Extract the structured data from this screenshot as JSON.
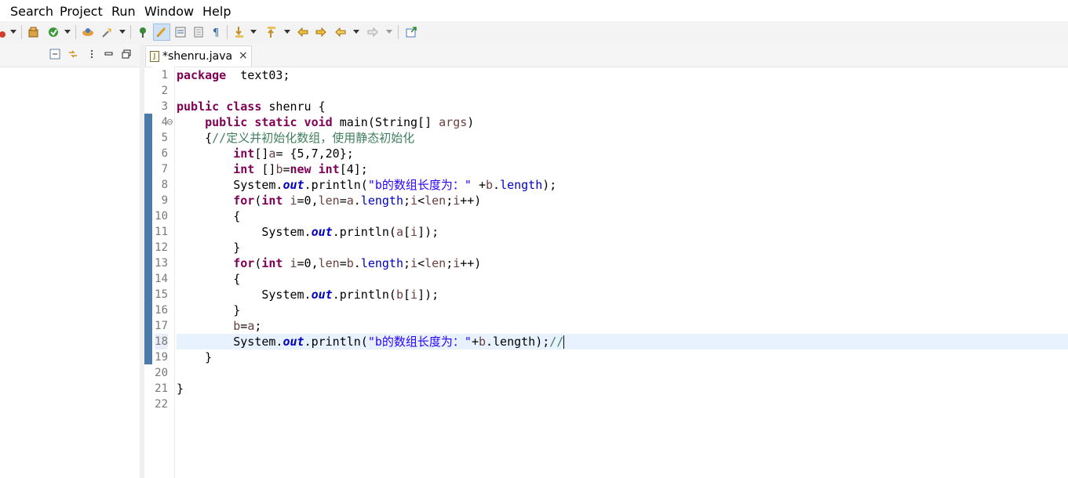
{
  "menu": [
    "Search",
    "Project",
    "Run",
    "Window",
    "Help"
  ],
  "editor": {
    "tab": {
      "label": "*shenru.java",
      "close": "×",
      "file_badge": "J"
    },
    "current_line": 18,
    "line_numbers": [
      "1",
      "2",
      "3",
      "4",
      "5",
      "6",
      "7",
      "8",
      "9",
      "10",
      "11",
      "12",
      "13",
      "14",
      "15",
      "16",
      "17",
      "18",
      "19",
      "20",
      "21",
      "22"
    ],
    "lines": [
      {
        "n": 1,
        "tokens": [
          [
            "kw",
            "package"
          ],
          [
            "",
            "  text03;"
          ]
        ]
      },
      {
        "n": 2,
        "tokens": []
      },
      {
        "n": 3,
        "tokens": [
          [
            "kw",
            "public class"
          ],
          [
            "",
            " shenru {"
          ]
        ]
      },
      {
        "n": 4,
        "tokens": [
          [
            "",
            "    "
          ],
          [
            "kw",
            "public static void"
          ],
          [
            "",
            " main(String[] "
          ],
          [
            "var",
            "args"
          ],
          [
            "",
            ")"
          ]
        ]
      },
      {
        "n": 5,
        "tokens": [
          [
            "",
            "    {"
          ],
          [
            "cmt",
            "//定义并初始化数组，使用静态初始化"
          ]
        ]
      },
      {
        "n": 6,
        "tokens": [
          [
            "",
            "        "
          ],
          [
            "kw",
            "int"
          ],
          [
            "",
            "[]"
          ],
          [
            "var",
            "a"
          ],
          [
            "",
            "= {5,7,20};"
          ]
        ]
      },
      {
        "n": 7,
        "tokens": [
          [
            "",
            "        "
          ],
          [
            "kw",
            "int"
          ],
          [
            "",
            " []"
          ],
          [
            "var",
            "b"
          ],
          [
            "",
            "="
          ],
          [
            "kw",
            "new"
          ],
          [
            "",
            " "
          ],
          [
            "kw",
            "int"
          ],
          [
            "",
            "[4];"
          ]
        ]
      },
      {
        "n": 8,
        "tokens": [
          [
            "",
            "        System."
          ],
          [
            "fld",
            "out"
          ],
          [
            "",
            ".println("
          ],
          [
            "str",
            "\"b的数组长度为：\""
          ],
          [
            "",
            " +"
          ],
          [
            "var",
            "b"
          ],
          [
            "",
            "."
          ],
          [
            "mem",
            "length"
          ],
          [
            "",
            ");"
          ]
        ]
      },
      {
        "n": 9,
        "tokens": [
          [
            "",
            "        "
          ],
          [
            "kw",
            "for"
          ],
          [
            "",
            "("
          ],
          [
            "kw",
            "int"
          ],
          [
            "",
            " "
          ],
          [
            "var",
            "i"
          ],
          [
            "",
            "=0,"
          ],
          [
            "var",
            "len"
          ],
          [
            "",
            "="
          ],
          [
            "var",
            "a"
          ],
          [
            "",
            "."
          ],
          [
            "mem",
            "length"
          ],
          [
            "",
            ";"
          ],
          [
            "var",
            "i"
          ],
          [
            "",
            "<"
          ],
          [
            "var",
            "len"
          ],
          [
            "",
            ";"
          ],
          [
            "var",
            "i"
          ],
          [
            "",
            "++)"
          ]
        ]
      },
      {
        "n": 10,
        "tokens": [
          [
            "",
            "        {"
          ]
        ]
      },
      {
        "n": 11,
        "tokens": [
          [
            "",
            "            System."
          ],
          [
            "fld",
            "out"
          ],
          [
            "",
            ".println("
          ],
          [
            "var",
            "a"
          ],
          [
            "",
            "["
          ],
          [
            "var",
            "i"
          ],
          [
            "",
            "]);"
          ]
        ]
      },
      {
        "n": 12,
        "tokens": [
          [
            "",
            "        }"
          ]
        ]
      },
      {
        "n": 13,
        "tokens": [
          [
            "",
            "        "
          ],
          [
            "kw",
            "for"
          ],
          [
            "",
            "("
          ],
          [
            "kw",
            "int"
          ],
          [
            "",
            " "
          ],
          [
            "var",
            "i"
          ],
          [
            "",
            "=0,"
          ],
          [
            "var",
            "len"
          ],
          [
            "",
            "="
          ],
          [
            "var",
            "b"
          ],
          [
            "",
            "."
          ],
          [
            "mem",
            "length"
          ],
          [
            "",
            ";"
          ],
          [
            "var",
            "i"
          ],
          [
            "",
            "<"
          ],
          [
            "var",
            "len"
          ],
          [
            "",
            ";"
          ],
          [
            "var",
            "i"
          ],
          [
            "",
            "++)"
          ]
        ]
      },
      {
        "n": 14,
        "tokens": [
          [
            "",
            "        {"
          ]
        ]
      },
      {
        "n": 15,
        "tokens": [
          [
            "",
            "            System."
          ],
          [
            "fld",
            "out"
          ],
          [
            "",
            ".println("
          ],
          [
            "var",
            "b"
          ],
          [
            "",
            "["
          ],
          [
            "var",
            "i"
          ],
          [
            "",
            "]);"
          ]
        ]
      },
      {
        "n": 16,
        "tokens": [
          [
            "",
            "        }"
          ]
        ]
      },
      {
        "n": 17,
        "tokens": [
          [
            "",
            "        "
          ],
          [
            "var",
            "b"
          ],
          [
            "",
            "="
          ],
          [
            "var",
            "a"
          ],
          [
            "",
            ";"
          ]
        ]
      },
      {
        "n": 18,
        "tokens": [
          [
            "",
            "        System."
          ],
          [
            "fld",
            "out"
          ],
          [
            "",
            ".println("
          ],
          [
            "str",
            "\"b的数组长度为：\""
          ],
          [
            "",
            "+"
          ],
          [
            "var",
            "b"
          ],
          [
            "",
            ".length);"
          ],
          [
            "cmt",
            "//"
          ]
        ]
      },
      {
        "n": 19,
        "tokens": [
          [
            "",
            "    }"
          ]
        ]
      },
      {
        "n": 20,
        "tokens": []
      },
      {
        "n": 21,
        "tokens": [
          [
            "",
            "}"
          ]
        ]
      },
      {
        "n": 22,
        "tokens": []
      }
    ]
  },
  "colors": {
    "keyword": "#7f0055",
    "string": "#2a00ff",
    "comment": "#3f7f5f",
    "field": "#0000c0",
    "variable": "#6a3e3e",
    "current_line": "#e8f2fe"
  },
  "icons": [
    "run-dropdown-icon",
    "new-project-icon",
    "debug-icon",
    "open-type-icon",
    "search-icon",
    "toggle-highlight-icon",
    "toggle-edit-icon",
    "show-whitespace-icon",
    "pilcrow-icon",
    "next-annotation-icon",
    "prev-annotation-icon",
    "back-icon",
    "forward-icon",
    "external-icon"
  ]
}
